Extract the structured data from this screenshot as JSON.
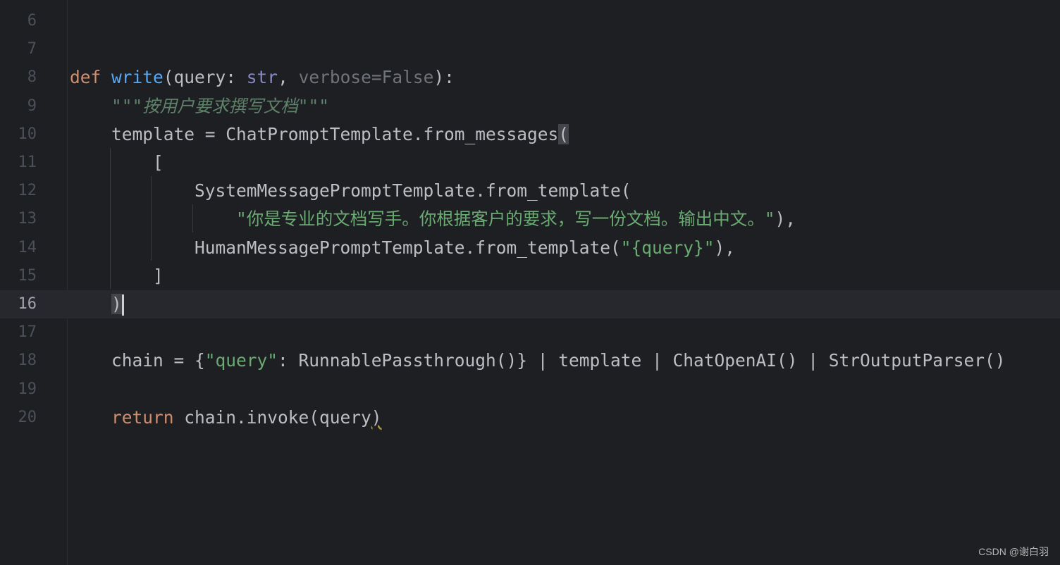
{
  "editor": {
    "current_line": 16,
    "lines": [
      {
        "n": "6",
        "tokens": []
      },
      {
        "n": "7",
        "tokens": []
      },
      {
        "n": "8",
        "tokens": [
          [
            "def ",
            "kw"
          ],
          [
            "write",
            "fn"
          ],
          [
            "(query: ",
            ""
          ],
          [
            "str",
            "bi"
          ],
          [
            ", ",
            ""
          ],
          [
            "verbose=False",
            "dim"
          ],
          [
            "):",
            ""
          ]
        ]
      },
      {
        "n": "9",
        "tokens": [
          [
            "    ",
            ""
          ],
          [
            "\"\"\"按用户要求撰写文档\"\"\"",
            "doc"
          ]
        ]
      },
      {
        "n": "10",
        "tokens": [
          [
            "    template = ChatPromptTemplate.from_messages",
            ""
          ],
          [
            "(",
            "br"
          ]
        ]
      },
      {
        "n": "11",
        "tokens": [
          [
            "        [",
            ""
          ]
        ]
      },
      {
        "n": "12",
        "tokens": [
          [
            "            SystemMessagePromptTemplate.from_template(",
            ""
          ]
        ]
      },
      {
        "n": "13",
        "tokens": [
          [
            "                ",
            ""
          ],
          [
            "\"你是专业的文档写手。你根据客户的要求，写一份文档。输出中文。\"",
            "str"
          ],
          [
            "),",
            ""
          ]
        ]
      },
      {
        "n": "14",
        "tokens": [
          [
            "            HumanMessagePromptTemplate.from_template(",
            ""
          ],
          [
            "\"{query}\"",
            "str"
          ],
          [
            "),",
            ""
          ]
        ]
      },
      {
        "n": "15",
        "tokens": [
          [
            "        ]",
            ""
          ]
        ]
      },
      {
        "n": "16",
        "tokens": [
          [
            "    ",
            ""
          ],
          [
            ")",
            "br"
          ]
        ]
      },
      {
        "n": "17",
        "tokens": []
      },
      {
        "n": "18",
        "tokens": [
          [
            "    chain = {",
            ""
          ],
          [
            "\"query\"",
            "str"
          ],
          [
            ": RunnablePassthrough()} | template | ChatOpenAI() | StrOutputParser()",
            ""
          ]
        ]
      },
      {
        "n": "19",
        "tokens": []
      },
      {
        "n": "20",
        "tokens": [
          [
            "    ",
            ""
          ],
          [
            "return",
            "kw"
          ],
          [
            " chain.invoke(query",
            ""
          ],
          [
            ")",
            "warn"
          ]
        ]
      }
    ]
  },
  "watermark": "CSDN @谢白羽"
}
